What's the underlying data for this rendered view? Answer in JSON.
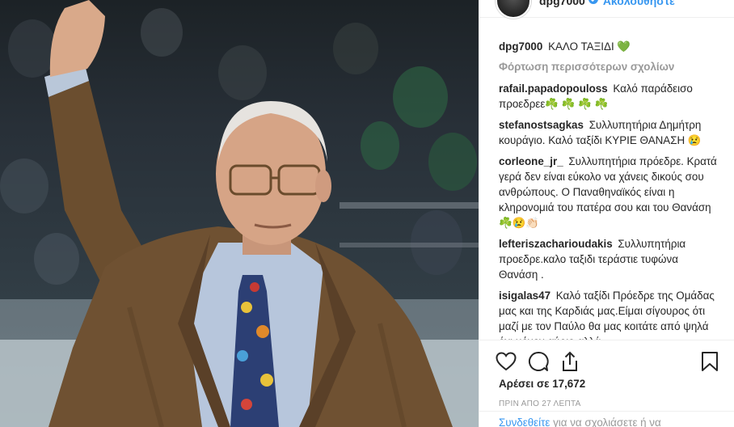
{
  "post": {
    "username": "dpg7000",
    "verified_icon": "verified-badge-icon",
    "follow_label": "Ακολουθήστε",
    "caption_text": "ΚΑΛΟ ΤΑΞΙΔΙ",
    "caption_emoji": "💚"
  },
  "comments_section": {
    "load_more": "Φόρτωση περισσότερων σχολίων",
    "items": [
      {
        "user": "rafail.papadopouloss",
        "text": "Καλό παράδεισο προεδρεε☘️ ☘️ ☘️ ☘️"
      },
      {
        "user": "stefanostsagkas",
        "text": "Συλλυπητήρια Δημήτρη κουράγιο. Καλό ταξίδι ΚΥΡΙΕ ΘΑΝΑΣΗ 😢"
      },
      {
        "user": "corleone_jr_",
        "text": "Συλλυπητήρια πρόεδρε. Κρατά γερά δεν είναι εύκολο να χάνεις δικούς σου ανθρώπους. Ο Παναθηναϊκός είναι η κληρονομιά του πατέρα σου και του Θανάση ☘️😢👏🏻"
      },
      {
        "user": "lefteriszacharioudakis",
        "text": "Συλλυπητήρια προεδρε.καλο ταξιδι τεράστιε τυφώνα Θανάση ."
      },
      {
        "user": "isigalas47",
        "text": "Καλό ταξίδι Πρόεδρε της Ομάδας μας και της Καρδιάς μας.Είμαι σίγουρος ότι μαζί με τον Παύλο θα μας κοιτάτε από ψηλά όχι μόνον αύριο αλλά"
      }
    ]
  },
  "actions": {
    "like_icon": "heart-outline-icon",
    "comment_icon": "comment-bubble-icon",
    "share_icon": "share-icon",
    "save_icon": "bookmark-icon",
    "likes_text": "Αρέσει σε 17,672",
    "timestamp": "ΠΡΙΝ ΑΠΟ 27 ΛΕΠΤΑ"
  },
  "login": {
    "link_text": "Συνδεθείτε",
    "rest_text": " για να σχολιάσετε ή να"
  },
  "colors": {
    "link_blue": "#3897f0",
    "text_dark": "#262626",
    "muted_gray": "#999999",
    "border": "#efefef"
  }
}
